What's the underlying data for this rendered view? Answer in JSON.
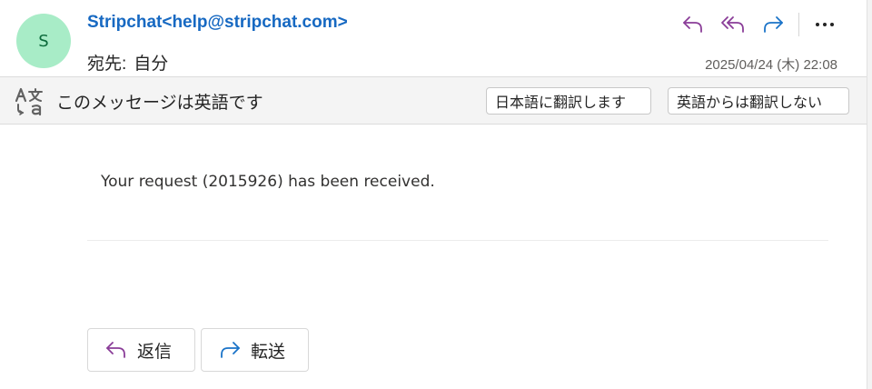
{
  "header": {
    "avatar_initial": "S",
    "sender": "Stripchat<help@stripchat.com>",
    "to_label": "宛先:",
    "to_name": "自分",
    "date": "2025/04/24 (木) 22:08"
  },
  "actions": [
    {
      "icon": "reply-icon",
      "color": "#8a3d98"
    },
    {
      "icon": "reply-all-icon",
      "color": "#8a3d98"
    },
    {
      "icon": "forward-icon",
      "color": "#1a73c8"
    },
    {
      "icon": "more-icon",
      "color": "#242424"
    }
  ],
  "translate_bar": {
    "icon": "translate-icon",
    "message": "このメッセージは英語です",
    "translate_button": "日本語に翻訳します",
    "dont_translate_button": "英語からは翻訳しない"
  },
  "body": {
    "text": "Your request (2015926) has been received."
  },
  "footer": {
    "reply_label": "返信",
    "forward_label": "転送"
  },
  "colors": {
    "sender": "#1769c2",
    "avatar_bg": "#a8ecc7",
    "reply_purple": "#8a3d98",
    "forward_blue": "#1a73c8"
  }
}
